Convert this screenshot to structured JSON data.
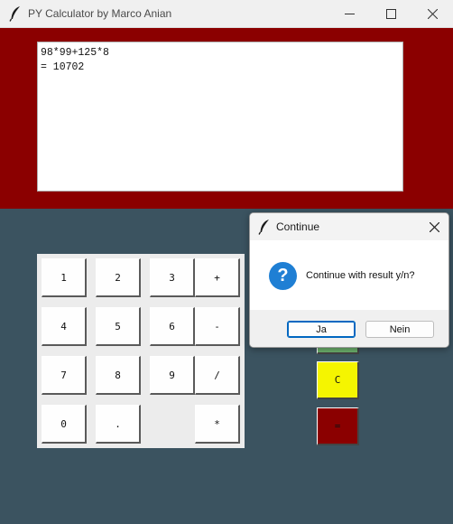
{
  "window": {
    "title": "PY Calculator by Marco Anian"
  },
  "display": {
    "lines": [
      "98*99+125*8",
      "= 10702"
    ]
  },
  "keypad": {
    "keys": [
      "1",
      "2",
      "3",
      "+",
      "4",
      "5",
      "6",
      "-",
      "7",
      "8",
      "9",
      "/",
      "0",
      ".",
      "*"
    ]
  },
  "side_buttons": [
    {
      "label": "C",
      "color": "#f5f500"
    },
    {
      "label": "=",
      "color": "#8b0000"
    }
  ],
  "colors": {
    "header": "#8b0000",
    "body": "#3b5360",
    "partially_hidden_button": "#6db36d"
  },
  "dialog": {
    "title": "Continue",
    "message": "Continue with result y/n?",
    "yes_label": "Ja",
    "no_label": "Nein"
  }
}
